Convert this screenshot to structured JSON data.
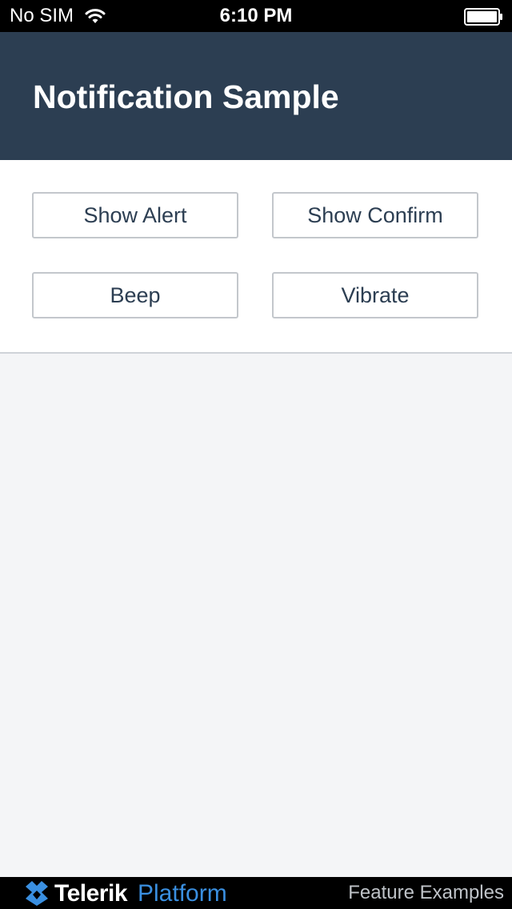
{
  "status_bar": {
    "carrier": "No SIM",
    "time": "6:10 PM"
  },
  "header": {
    "title": "Notification Sample"
  },
  "buttons": {
    "show_alert": "Show Alert",
    "show_confirm": "Show Confirm",
    "beep": "Beep",
    "vibrate": "Vibrate"
  },
  "footer": {
    "brand_primary": "Telerik",
    "brand_secondary": "Platform",
    "link": "Feature Examples"
  },
  "colors": {
    "header_bg": "#2c3e52",
    "accent_blue": "#3a8fe0",
    "content_bg": "#f4f5f7"
  },
  "icons": [
    "wifi-icon",
    "battery-icon",
    "telerik-logo-icon"
  ]
}
